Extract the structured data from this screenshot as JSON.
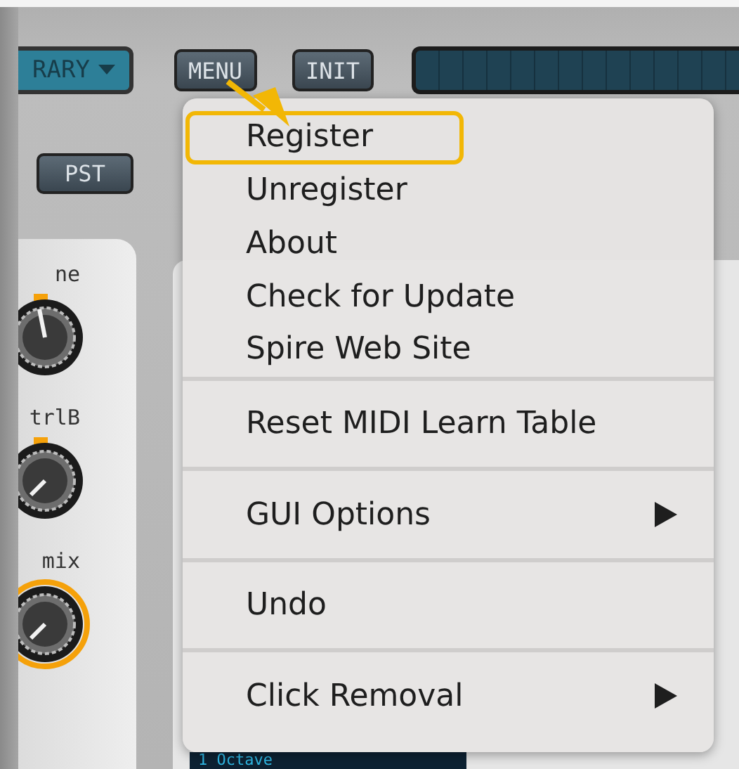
{
  "header": {
    "dropdown": {
      "label": "RARY"
    },
    "buttons": [
      "MENU",
      "INIT"
    ],
    "preset_button": "PST"
  },
  "knobs": [
    {
      "label": "ne",
      "ring": false
    },
    {
      "label": "trlB",
      "ring": false
    },
    {
      "label": "mix",
      "ring": true
    }
  ],
  "display_text": "1 Octave",
  "menu": {
    "items": [
      {
        "kind": "item",
        "label": "Register",
        "highlighted": true,
        "submenu": false
      },
      {
        "kind": "item",
        "label": "Unregister",
        "highlighted": false,
        "submenu": false
      },
      {
        "kind": "item",
        "label": "About",
        "highlighted": false,
        "submenu": false
      },
      {
        "kind": "item",
        "label": "Check for Update",
        "highlighted": false,
        "submenu": false
      },
      {
        "kind": "item",
        "label": "Spire Web Site",
        "highlighted": false,
        "submenu": false
      },
      {
        "kind": "separator"
      },
      {
        "kind": "item",
        "label": "Reset MIDI Learn Table",
        "highlighted": false,
        "submenu": false
      },
      {
        "kind": "separator"
      },
      {
        "kind": "item",
        "label": "GUI Options",
        "highlighted": false,
        "submenu": true
      },
      {
        "kind": "separator"
      },
      {
        "kind": "item",
        "label": "Undo",
        "highlighted": false,
        "submenu": false
      },
      {
        "kind": "separator"
      },
      {
        "kind": "item",
        "label": "Click Removal",
        "highlighted": false,
        "submenu": true
      }
    ]
  }
}
